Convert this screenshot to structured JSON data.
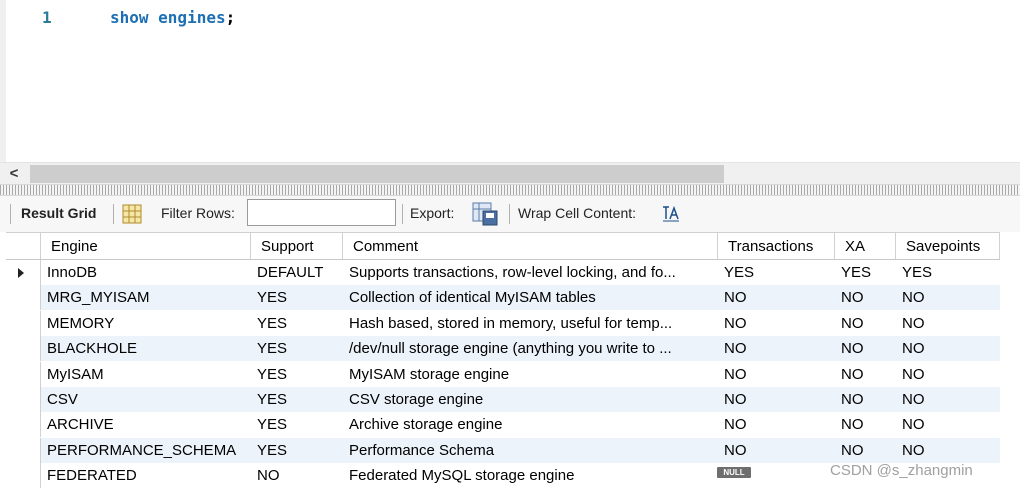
{
  "editor": {
    "line_number": "1",
    "code_keyword": "show engines",
    "code_punct": ";"
  },
  "scrollbar": {
    "left_arrow": "<"
  },
  "toolbar": {
    "result_grid_label": "Result Grid",
    "filter_rows_label": "Filter Rows:",
    "filter_value": "",
    "export_label": "Export:",
    "wrap_label": "Wrap Cell Content:"
  },
  "grid": {
    "columns": [
      "Engine",
      "Support",
      "Comment",
      "Transactions",
      "XA",
      "Savepoints"
    ],
    "rows": [
      [
        "InnoDB",
        "DEFAULT",
        "Supports transactions, row-level locking, and fo...",
        "YES",
        "YES",
        "YES"
      ],
      [
        "MRG_MYISAM",
        "YES",
        "Collection of identical MyISAM tables",
        "NO",
        "NO",
        "NO"
      ],
      [
        "MEMORY",
        "YES",
        "Hash based, stored in memory, useful for temp...",
        "NO",
        "NO",
        "NO"
      ],
      [
        "BLACKHOLE",
        "YES",
        "/dev/null storage engine (anything you write to ...",
        "NO",
        "NO",
        "NO"
      ],
      [
        "MyISAM",
        "YES",
        "MyISAM storage engine",
        "NO",
        "NO",
        "NO"
      ],
      [
        "CSV",
        "YES",
        "CSV storage engine",
        "NO",
        "NO",
        "NO"
      ],
      [
        "ARCHIVE",
        "YES",
        "Archive storage engine",
        "NO",
        "NO",
        "NO"
      ],
      [
        "PERFORMANCE_SCHEMA",
        "YES",
        "Performance Schema",
        "NO",
        "NO",
        "NO"
      ],
      [
        "FEDERATED",
        "NO",
        "Federated MySQL storage engine",
        "NULL",
        "",
        ""
      ]
    ]
  },
  "watermark": "CSDN @s_zhangmin",
  "colors": {
    "keyword": "#1c6fb3",
    "row_alt": "#edf3fb",
    "null_badge": "#6e6e6e"
  }
}
